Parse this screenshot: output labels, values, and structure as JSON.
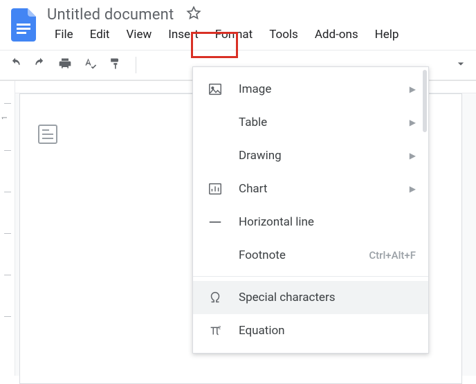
{
  "header": {
    "doc_title": "Untitled document"
  },
  "menubar": {
    "items": [
      "File",
      "Edit",
      "View",
      "Insert",
      "Format",
      "Tools",
      "Add-ons",
      "Help"
    ],
    "active_index": 3
  },
  "dropdown": {
    "image": "Image",
    "table": "Table",
    "drawing": "Drawing",
    "chart": "Chart",
    "hline": "Horizontal line",
    "footnote": "Footnote",
    "footnote_shortcut": "Ctrl+Alt+F",
    "special": "Special characters",
    "equation": "Equation"
  }
}
